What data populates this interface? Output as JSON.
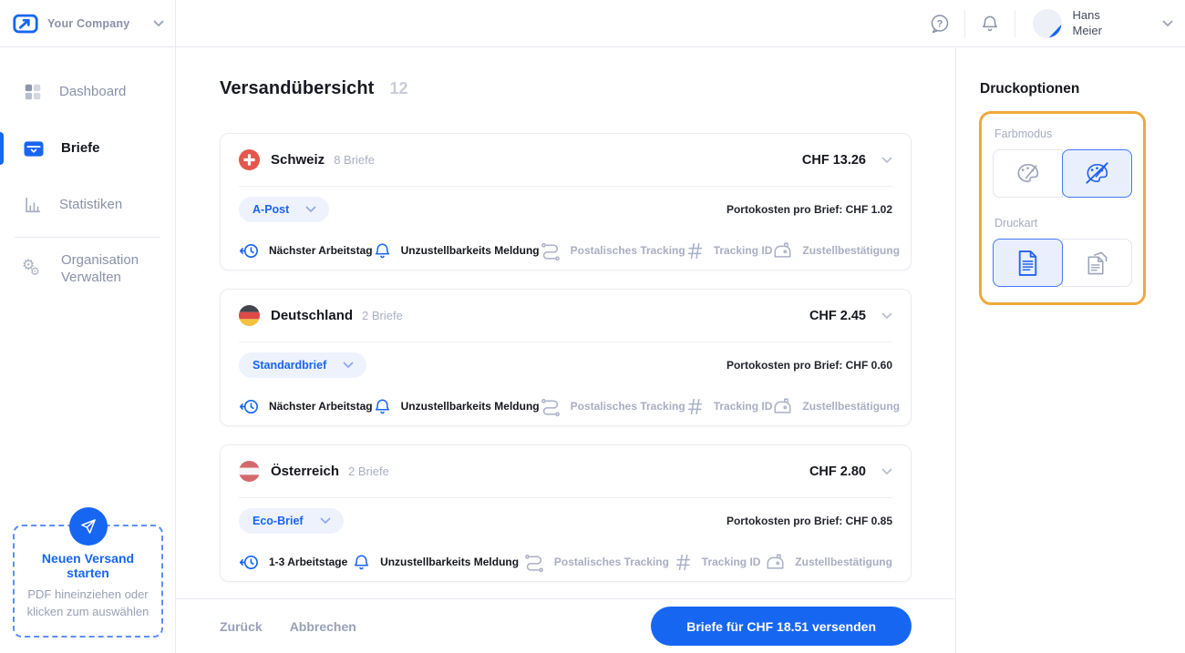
{
  "brand": {
    "company": "Your Company"
  },
  "header": {
    "user": {
      "name_line1": "Hans",
      "name_line2": "Meier"
    },
    "icons": [
      "help-icon",
      "bell-icon",
      "avatar"
    ]
  },
  "sidebar": {
    "items": [
      {
        "label": "Dashboard",
        "icon": "dashboard-icon",
        "active": false
      },
      {
        "label": "Briefe",
        "icon": "letter-icon",
        "active": true
      },
      {
        "label": "Statistiken",
        "icon": "chart-icon",
        "active": false
      },
      {
        "label": "Organisation Verwalten",
        "icon": "gears-icon",
        "active": false
      }
    ],
    "dropzone": {
      "title": "Neuen Versand starten",
      "subtitle": "PDF hineinziehen oder klicken zum auswählen",
      "icon": "paper-plane-icon"
    }
  },
  "main": {
    "title": "Versandübersicht",
    "count": "12",
    "cards": [
      {
        "country": "Schweiz",
        "flag": "flag-ch",
        "count_label": "8 Briefe",
        "total": "CHF 13.26",
        "product": "A-Post",
        "postage_label": "Portokosten pro Brief: CHF 1.02",
        "features": [
          {
            "icon": "clock-arrow-icon",
            "label": "Nächster Arbeitstag",
            "enabled": true
          },
          {
            "icon": "bell-icon",
            "label": "Unzustellbarkeits Meldung",
            "enabled": true
          },
          {
            "icon": "route-icon",
            "label": "Postalisches Tracking",
            "enabled": false
          },
          {
            "icon": "hash-icon",
            "label": "Tracking ID",
            "enabled": false
          },
          {
            "icon": "mailbox-icon",
            "label": "Zustellbestätigung",
            "enabled": false
          }
        ]
      },
      {
        "country": "Deutschland",
        "flag": "flag-de",
        "count_label": "2 Briefe",
        "total": "CHF 2.45",
        "product": "Standardbrief",
        "postage_label": "Portokosten pro Brief: CHF 0.60",
        "features": [
          {
            "icon": "clock-arrow-icon",
            "label": "Nächster Arbeitstag",
            "enabled": true
          },
          {
            "icon": "bell-icon",
            "label": "Unzustellbarkeits Meldung",
            "enabled": true
          },
          {
            "icon": "route-icon",
            "label": "Postalisches Tracking",
            "enabled": false
          },
          {
            "icon": "hash-icon",
            "label": "Tracking ID",
            "enabled": false
          },
          {
            "icon": "mailbox-icon",
            "label": "Zustellbestätigung",
            "enabled": false
          }
        ]
      },
      {
        "country": "Österreich",
        "flag": "flag-at",
        "count_label": "2 Briefe",
        "total": "CHF 2.80",
        "product": "Eco-Brief",
        "postage_label": "Portokosten pro Brief: CHF 0.85",
        "features": [
          {
            "icon": "clock-arrow-icon",
            "label": "1-3 Arbeitstage",
            "enabled": true
          },
          {
            "icon": "bell-icon",
            "label": "Unzustellbarkeits Meldung",
            "enabled": true
          },
          {
            "icon": "route-icon",
            "label": "Postalisches Tracking",
            "enabled": false
          },
          {
            "icon": "hash-icon",
            "label": "Tracking ID",
            "enabled": false
          },
          {
            "icon": "mailbox-icon",
            "label": "Zustellbestätigung",
            "enabled": false
          }
        ]
      }
    ],
    "footer": {
      "back": "Zurück",
      "cancel": "Abbrechen",
      "send": "Briefe für CHF 18.51 versenden"
    }
  },
  "print_options": {
    "title": "Druckoptionen",
    "color_mode": {
      "label": "Farbmodus",
      "options": [
        {
          "icon": "palette-icon",
          "selected": false
        },
        {
          "icon": "palette-crossed-icon",
          "selected": true
        }
      ]
    },
    "print_type": {
      "label": "Druckart",
      "options": [
        {
          "icon": "document-simplex-icon",
          "selected": true
        },
        {
          "icon": "document-duplex-icon",
          "selected": false
        }
      ]
    }
  },
  "colors": {
    "primary_blue": "#1766f2",
    "selected_border_blue": "#4577f6",
    "selected_fill_blue": "#e9effd",
    "highlight_orange": "#f2a93b",
    "muted_text": "#a9aec2",
    "swiss_red": "#e4574e",
    "german_black": "#42454d",
    "german_red": "#dd4a47",
    "german_gold": "#f2c33f",
    "austrian_red": "#d4696b"
  }
}
